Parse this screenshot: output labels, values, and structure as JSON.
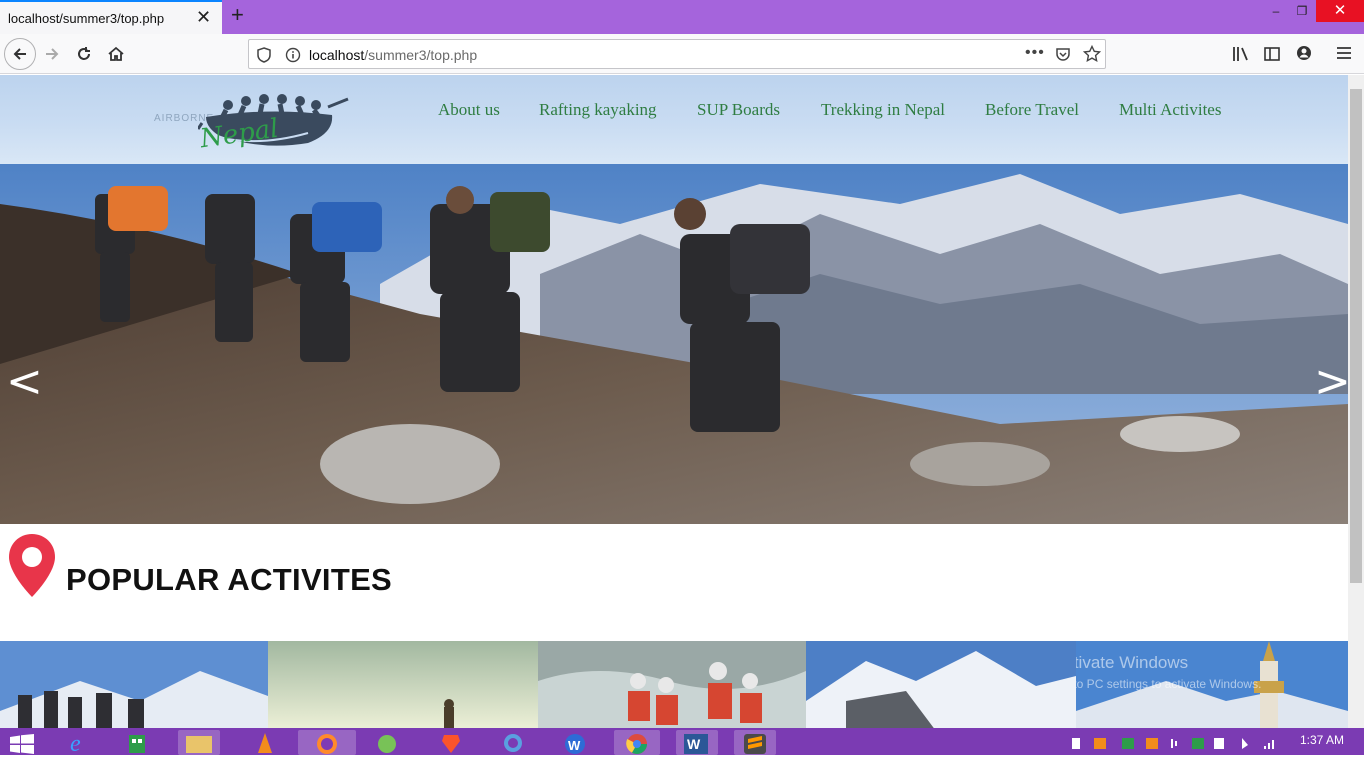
{
  "browser": {
    "tab_title": "localhost/summer3/top.php",
    "tab_close": "✕",
    "new_tab": "+",
    "url_host": "localhost",
    "url_path": "/summer3/top.php",
    "window_controls": {
      "minimize": "–",
      "maximize": "❐",
      "close": "✕"
    }
  },
  "site": {
    "logo_text": "Nepal",
    "logo_small_text": "AIRBORNE",
    "nav": [
      {
        "label": "About us"
      },
      {
        "label": "Rafting kayaking"
      },
      {
        "label": "SUP Boards"
      },
      {
        "label": "Trekking in Nepal"
      },
      {
        "label": "Before Travel"
      },
      {
        "label": "Multi Activites"
      }
    ],
    "carousel": {
      "prev": "<",
      "next": ">"
    },
    "section_title": "POPULAR ACTIVITES"
  },
  "watermark": {
    "line1": "Activate Windows",
    "line2": "Go to PC settings to activate Windows."
  },
  "taskbar": {
    "clock": "1:37 AM"
  }
}
